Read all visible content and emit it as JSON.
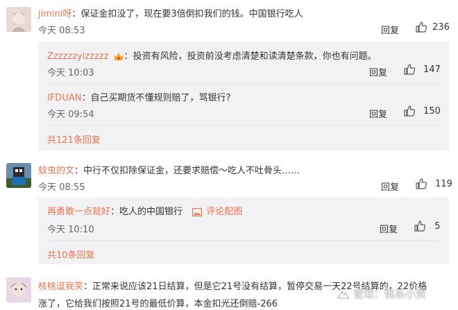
{
  "comments": [
    {
      "user": "jimini呀",
      "text": "保证金扣没了，现在要3倍倒扣我们的钱。中国银行吃人",
      "time": "今天 08:53",
      "reply_label": "回复",
      "likes": "236",
      "replies": [
        {
          "user": "Zzzzzzyizzzzz",
          "text": "投资有风险，投资前没考虑清楚和读清楚条款，你也有问题。",
          "time": "今天 10:03",
          "reply_label": "回复",
          "likes": "147"
        },
        {
          "user": "IFDUAN",
          "text": "自己买期货不懂规则赔了，骂银行?",
          "time": "今天 09:54",
          "reply_label": "回复",
          "likes": "150"
        }
      ],
      "more_replies": "共121条回复"
    },
    {
      "user": "蚊虫的文",
      "text": "中行不仅扣除保证金，还要求赔偿～吃人不吐骨头……",
      "time": "今天 08:55",
      "reply_label": "回复",
      "likes": "119",
      "replies": [
        {
          "user": "再勇敢一点就好",
          "text": "吃人的中国银行",
          "image_link": "评论配图",
          "time": "今天 10:10",
          "reply_label": "回复",
          "likes": "5"
        }
      ],
      "more_replies": "共10条回复"
    },
    {
      "user": "核桃逗我笑",
      "text_line1": "正常来说应该21日结算，但是它21号没有结算，暂停交易一天22号结算的，22价格",
      "text_line2": "涨了，它给我们按照21号的最低价算，本金扣光还倒赔-266"
    }
  ],
  "watermark": "雪球：佛系小资",
  "colors": {
    "name": "#eb7350",
    "reply_bg": "#f2f2f5"
  }
}
